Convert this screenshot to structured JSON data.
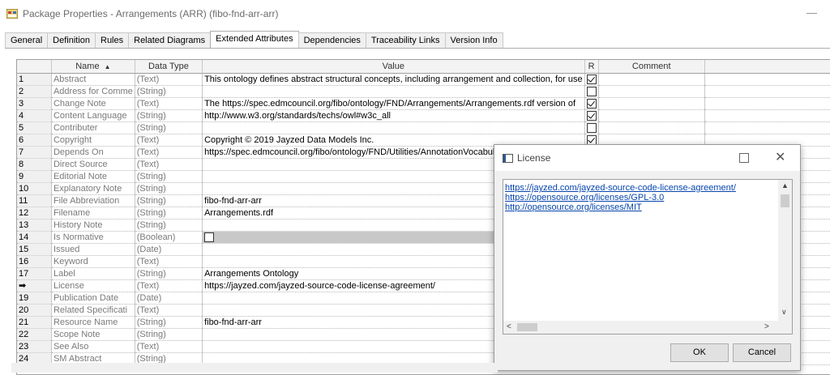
{
  "window": {
    "title": "Package Properties - Arrangements (ARR) (fibo-fnd-arr-arr)",
    "minimize_glyph": "—"
  },
  "tabs": [
    {
      "label": "General"
    },
    {
      "label": "Definition"
    },
    {
      "label": "Rules"
    },
    {
      "label": "Related Diagrams"
    },
    {
      "label": "Extended Attributes",
      "active": true
    },
    {
      "label": "Dependencies"
    },
    {
      "label": "Traceability Links"
    },
    {
      "label": "Version Info"
    }
  ],
  "grid": {
    "headers": {
      "name": "Name",
      "datatype": "Data Type",
      "value": "Value",
      "r": "R",
      "comment": "Comment"
    },
    "rows": [
      {
        "num": "1",
        "name": "Abstract",
        "type": "(Text)",
        "value": "This ontology defines abstract structural concepts, including arrangement and collection, for use",
        "r": true
      },
      {
        "num": "2",
        "name": "Address for Comme",
        "type": "(String)",
        "value": "",
        "r": false
      },
      {
        "num": "3",
        "name": "Change Note",
        "type": "(Text)",
        "value": "The https://spec.edmcouncil.org/fibo/ontology/FND/Arrangements/Arrangements.rdf version of",
        "r": true
      },
      {
        "num": "4",
        "name": "Content Language",
        "type": "(String)",
        "value": "http://www.w3.org/standards/techs/owl#w3c_all",
        "r": true
      },
      {
        "num": "5",
        "name": "Contributer",
        "type": "(String)",
        "value": "",
        "r": false
      },
      {
        "num": "6",
        "name": "Copyright",
        "type": "(Text)",
        "value": "Copyright © 2019 Jayzed Data Models Inc.",
        "r": true
      },
      {
        "num": "7",
        "name": "Depends On",
        "type": "(Text)",
        "value": "https://spec.edmcouncil.org/fibo/ontology/FND/Utilities/AnnotationVocabul",
        "r": null
      },
      {
        "num": "8",
        "name": "Direct Source",
        "type": "(Text)",
        "value": "",
        "r": null
      },
      {
        "num": "9",
        "name": "Editorial Note",
        "type": "(String)",
        "value": "",
        "r": null
      },
      {
        "num": "10",
        "name": "Explanatory Note",
        "type": "(String)",
        "value": "",
        "r": null
      },
      {
        "num": "11",
        "name": "File Abbreviation",
        "type": "(String)",
        "value": "fibo-fnd-arr-arr",
        "r": null
      },
      {
        "num": "12",
        "name": "Filename",
        "type": "(String)",
        "value": "Arrangements.rdf",
        "r": null
      },
      {
        "num": "13",
        "name": "History Note",
        "type": "(String)",
        "value": "",
        "r": null
      },
      {
        "num": "14",
        "name": "Is Normative",
        "type": "(Boolean)",
        "value": "",
        "r": null,
        "checkbox": true
      },
      {
        "num": "15",
        "name": "Issued",
        "type": "(Date)",
        "value": "",
        "r": null
      },
      {
        "num": "16",
        "name": "Keyword",
        "type": "(Text)",
        "value": "",
        "r": null
      },
      {
        "num": "17",
        "name": "Label",
        "type": "(String)",
        "value": "Arrangements Ontology",
        "r": null
      },
      {
        "num": "➡",
        "name": "License",
        "type": "(Text)",
        "value": "https://jayzed.com/jayzed-source-code-license-agreement/",
        "r": null
      },
      {
        "num": "19",
        "name": "Publication Date",
        "type": "(Date)",
        "value": "",
        "r": null
      },
      {
        "num": "20",
        "name": "Related Specificati",
        "type": "(Text)",
        "value": "",
        "r": null
      },
      {
        "num": "21",
        "name": "Resource Name",
        "type": "(String)",
        "value": "fibo-fnd-arr-arr",
        "r": null
      },
      {
        "num": "22",
        "name": "Scope Note",
        "type": "(String)",
        "value": "",
        "r": null
      },
      {
        "num": "23",
        "name": "See Also",
        "type": "(Text)",
        "value": "",
        "r": null
      },
      {
        "num": "24",
        "name": "SM Abstract",
        "type": "(String)",
        "value": "",
        "r": null
      }
    ]
  },
  "dialog": {
    "title": "License",
    "links": [
      "https://jayzed.com/jayzed-source-code-license-agreement/",
      "https://opensource.org/licenses/GPL-3.0",
      "http://opensource.org/licenses/MIT"
    ],
    "ok_label": "OK",
    "cancel_label": "Cancel",
    "close_glyph": "✕",
    "up_glyph": "▲",
    "down_glyph": "∨",
    "left_glyph": "<",
    "right_glyph": ">"
  }
}
